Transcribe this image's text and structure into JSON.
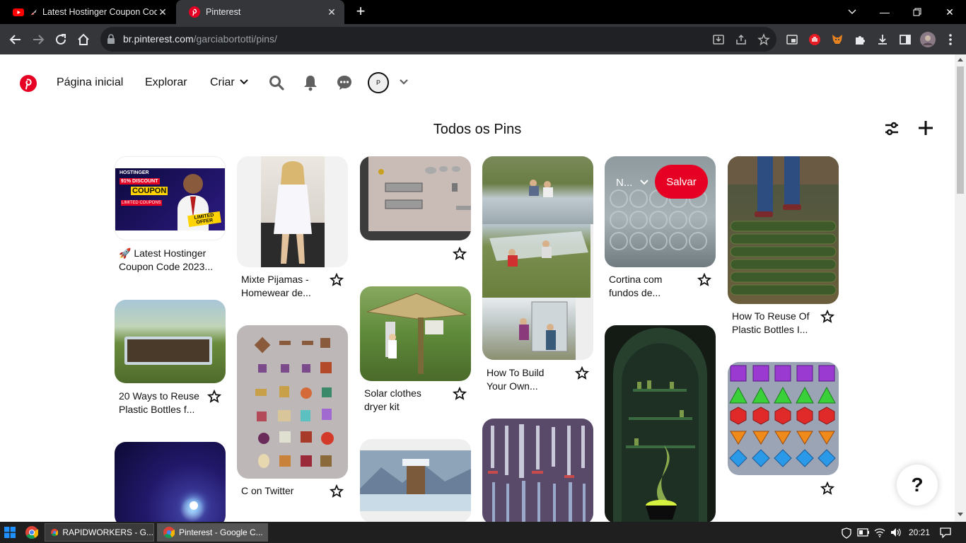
{
  "browser": {
    "tabs": [
      {
        "title": "Latest Hostinger Coupon Code",
        "favicon": "youtube-icon"
      },
      {
        "title": "Pinterest",
        "favicon": "pinterest-icon"
      }
    ],
    "url_host": "br.pinterest.com",
    "url_path": "/garciabortotti/pins/"
  },
  "header": {
    "home": "Página inicial",
    "explore": "Explorar",
    "create": "Criar",
    "avatar_initial": "P"
  },
  "main": {
    "title": "Todos os Pins",
    "hover_board": "N...",
    "save_label": "Salvar",
    "help": "?"
  },
  "pins": [
    {
      "title": "🚀 Latest Hostinger Coupon Code 2023..."
    },
    {
      "title": "20 Ways to Reuse Plastic Bottles f..."
    },
    {
      "title": "Mixte Pijamas - Homewear de..."
    },
    {
      "title": "C on Twitter"
    },
    {
      "title": "Solar clothes dryer kit"
    },
    {
      "title": "How To Build Your Own..."
    },
    {
      "title": "Cortina com fundos de..."
    },
    {
      "title": "How To Reuse Of Plastic Bottles I..."
    }
  ],
  "ad": {
    "brand": "HOSTINGER",
    "discount": "91% DISCOUNT",
    "coupon": "COUPON",
    "limited": "LIMITED COUPONS",
    "offer": "LIMITED OFFER"
  },
  "taskbar": {
    "apps": [
      "RAPIDWORKERS - G...",
      "Pinterest - Google C..."
    ],
    "time": "20:21"
  },
  "colors": {
    "pinterest_red": "#e60023",
    "chrome_dark": "#35363a"
  }
}
